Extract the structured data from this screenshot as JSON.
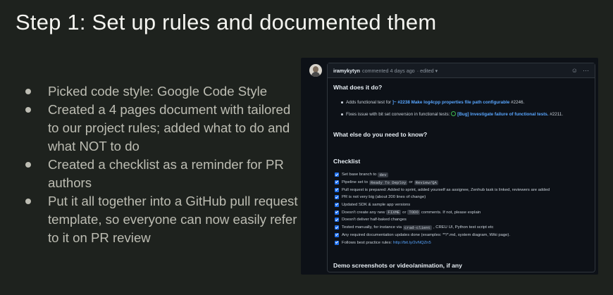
{
  "slide": {
    "title": "Step 1: Set up rules and documented them",
    "bullets": [
      "Picked code style: Google Code Style",
      "Created a 4 pages document with tailored to our project rules; added what to do and what NOT to do",
      "Created a checklist as a reminder for PR authors",
      "Put it all together into a GitHub pull request template, so everyone can now easily refer to it on PR review"
    ]
  },
  "github": {
    "author": "iramykytyn",
    "meta": "commented 4 days ago",
    "edited": "· edited ▾",
    "icons": [
      "smiley-icon",
      "kebab-menu-icon"
    ],
    "what_heading": "What does it do?",
    "what_items": [
      {
        "prefix": "Adds functional test for ",
        "link": "]~ #2238 Make log4cpp properties file path configurable",
        "suffix": " #2246."
      },
      {
        "prefix": "Fixes issue with bit set conversion in functional tests: ",
        "link": "[Bug] Investigate failure of functional tests.",
        "suffix": " #2211."
      }
    ],
    "else_heading": "What else do you need to know?",
    "checklist_heading": "Checklist",
    "checklist": {
      "c1_text": "Set base branch to",
      "c1_code": "dev",
      "c2_text": "Pipeline set to",
      "c2_code1": "Ready To Deploy",
      "c2_or": "or",
      "c2_code2": "Review/QA",
      "c3_text": "Pull request is prepared: Added to sprint, added yourself as assignee, Zenhub task is linked, reviewers are added",
      "c4_text": "PR is not very big (about 200 lines of change)",
      "c5_text": "Updated SDK & sample app versions",
      "c6_text1": "Doesn't create any new",
      "c6_code1": "FIXME",
      "c6_or": "or",
      "c6_code2": "TODO",
      "c6_text2": "comments. If not, please explain",
      "c7_text": "Doesn't deliver half-baked changes",
      "c8_text1": "Tested manually, for instance via",
      "c8_code": "crad-client",
      "c8_text2": ", CREU UI, Python test script etc",
      "c9_text": "Any required documentation updates done (examples: **/*.md, system diagram, Wiki page).",
      "c10_text": "Follows best practice rules:",
      "c10_link": "http://bit.ly/2vNQZn5"
    },
    "demo_heading": "Demo screenshots or video/animation, if any"
  }
}
